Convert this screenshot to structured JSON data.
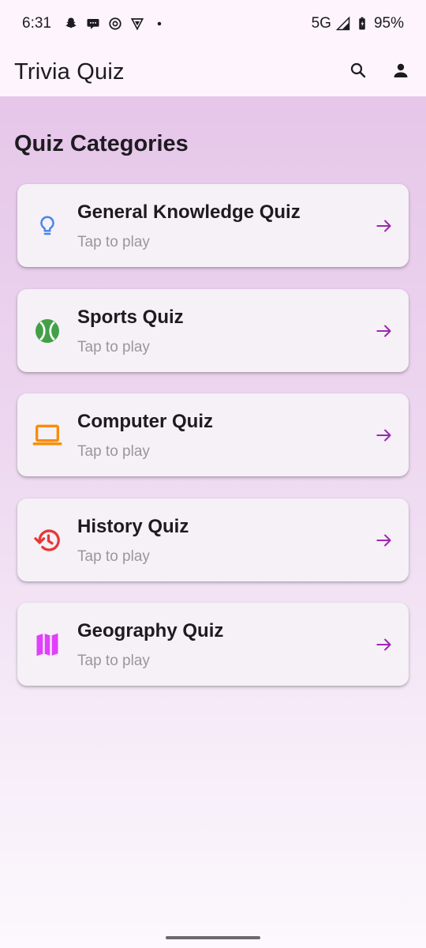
{
  "status_bar": {
    "time": "6:31",
    "network": "5G",
    "battery": "95%"
  },
  "app_bar": {
    "title": "Trivia Quiz",
    "actions": [
      "search-icon",
      "account-icon"
    ]
  },
  "main": {
    "section_title": "Quiz Categories",
    "categories": [
      {
        "title": "General Knowledge Quiz",
        "subtitle": "Tap to play",
        "icon": "lightbulb-icon",
        "color": "#4a86e8"
      },
      {
        "title": "Sports Quiz",
        "subtitle": "Tap to play",
        "icon": "tennis-ball-icon",
        "color": "#43a047"
      },
      {
        "title": "Computer Quiz",
        "subtitle": "Tap to play",
        "icon": "laptop-icon",
        "color": "#fb8c00"
      },
      {
        "title": "History Quiz",
        "subtitle": "Tap to play",
        "icon": "history-icon",
        "color": "#e53935"
      },
      {
        "title": "Geography Quiz",
        "subtitle": "Tap to play",
        "icon": "map-icon",
        "color": "#e040fb"
      }
    ],
    "arrow_color": "#9c27b0"
  }
}
